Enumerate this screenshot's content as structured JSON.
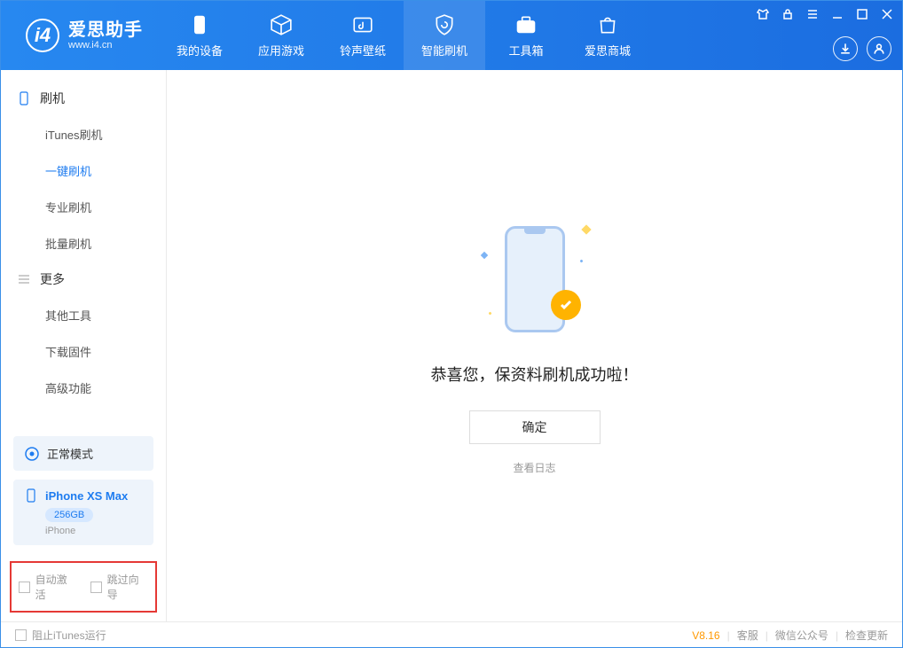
{
  "app": {
    "title": "爱思助手",
    "subtitle": "www.i4.cn"
  },
  "nav": {
    "items": [
      {
        "label": "我的设备"
      },
      {
        "label": "应用游戏"
      },
      {
        "label": "铃声壁纸"
      },
      {
        "label": "智能刷机"
      },
      {
        "label": "工具箱"
      },
      {
        "label": "爱思商城"
      }
    ]
  },
  "sidebar": {
    "group1": {
      "title": "刷机"
    },
    "flash_items": [
      {
        "label": "iTunes刷机"
      },
      {
        "label": "一键刷机"
      },
      {
        "label": "专业刷机"
      },
      {
        "label": "批量刷机"
      }
    ],
    "group2": {
      "title": "更多"
    },
    "more_items": [
      {
        "label": "其他工具"
      },
      {
        "label": "下载固件"
      },
      {
        "label": "高级功能"
      }
    ],
    "mode": "正常模式",
    "device": {
      "name": "iPhone XS Max",
      "storage": "256GB",
      "type": "iPhone"
    },
    "options": {
      "auto_activate": "自动激活",
      "skip_guide": "跳过向导"
    }
  },
  "main": {
    "success_text": "恭喜您，保资料刷机成功啦！",
    "ok_button": "确定",
    "view_log": "查看日志"
  },
  "footer": {
    "block_itunes": "阻止iTunes运行",
    "version": "V8.16",
    "links": {
      "service": "客服",
      "wechat": "微信公众号",
      "update": "检查更新"
    }
  }
}
